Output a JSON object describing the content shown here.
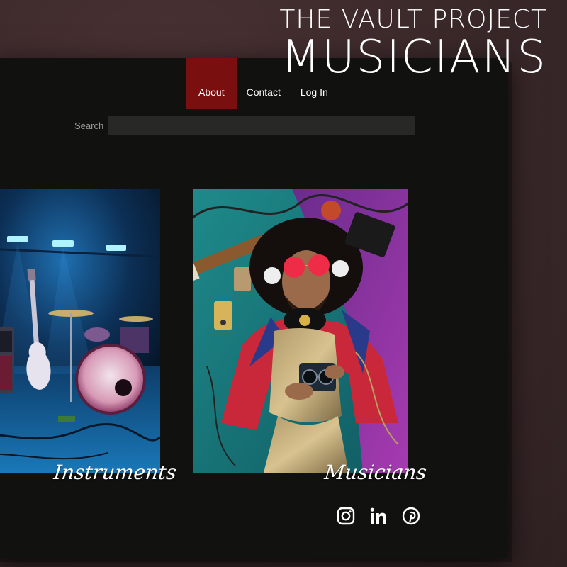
{
  "brand": {
    "line1": "THE VAULT PROJECT",
    "line2": "MUSICIANS"
  },
  "nav": {
    "items": [
      {
        "label": "About",
        "active": true
      },
      {
        "label": "Contact",
        "active": false
      },
      {
        "label": "Log In",
        "active": false
      }
    ]
  },
  "search": {
    "label": "Search",
    "value": "",
    "placeholder": ""
  },
  "cards": [
    {
      "caption": "Instruments",
      "image": "concert-stage-drum-kit-guitar"
    },
    {
      "caption": "Musicians",
      "image": "musician-lying-with-headphones-and-guitar"
    }
  ],
  "social": {
    "icons": [
      "instagram-icon",
      "linkedin-icon",
      "pinterest-icon"
    ]
  },
  "colors": {
    "background": "#3a2829",
    "window": "#11110f",
    "nav_active": "#7a0f10",
    "search_field": "#282926",
    "text": "#ffffff"
  }
}
